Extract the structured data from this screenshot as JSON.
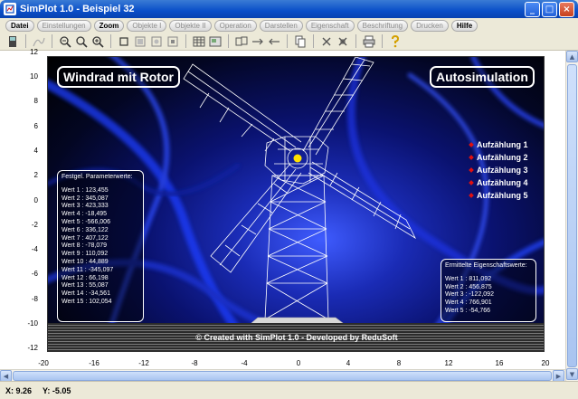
{
  "window": {
    "title": "SimPlot 1.0 - Beispiel 32",
    "minimize": "_",
    "maximize": "□",
    "close": "×"
  },
  "menu": [
    "Datei",
    "Einstellungen",
    "Zoom",
    "Objekte I",
    "Objekte II",
    "Operation",
    "Darstellen",
    "Eigenschaft",
    "Beschriftung",
    "Drucken",
    "Hilfe"
  ],
  "toolbar_icons": [
    "device-icon",
    "curve-icon",
    "zoom-in-icon",
    "zoom-icon",
    "zoom-plus-icon",
    "square-icon",
    "box-icon",
    "box2-icon",
    "box3-icon",
    "grid-icon",
    "grid2-icon",
    "copy-icon",
    "arrow-right-icon",
    "arrow-left-icon",
    "pages-icon",
    "cross-icon",
    "cross2-icon",
    "print-icon",
    "help-icon"
  ],
  "axes": {
    "y_ticks": [
      "12",
      "10",
      "8",
      "6",
      "4",
      "2",
      "0",
      "-2",
      "-4",
      "-6",
      "-8",
      "-10",
      "-12"
    ],
    "x_ticks": [
      "-20",
      "-16",
      "-12",
      "-8",
      "-4",
      "0",
      "4",
      "8",
      "12",
      "16",
      "20"
    ]
  },
  "chart": {
    "title": "Windrad mit Rotor",
    "mode": "Autosimulation",
    "params_title": "Festgel. Parameterwerte:",
    "params": [
      "Wert 1 : 123,455",
      "Wert 2 : 345,087",
      "Wert 3 : 423,333",
      "Wert 4 : -18,495",
      "Wert 5 : -566,006",
      "Wert 6 : 336,122",
      "Wert 7 : 407,122",
      "Wert 8 : -78,079",
      "Wert 9 : 110,092",
      "Wert 10 : 44,889",
      "Wert 11 : -345,097",
      "Wert 12 : 66,198",
      "Wert 13 : 55,087",
      "Wert 14 : -34,561",
      "Wert 15 : 102,054"
    ],
    "enumeration": [
      "Aufzählung 1",
      "Aufzählung 2",
      "Aufzählung 3",
      "Aufzählung 4",
      "Aufzählung 5"
    ],
    "results_title": "Ermittelte Eigenschaftswerte:",
    "results": [
      "Wert 1 : 811,092",
      "Wert 2 : 456,875",
      "Wert 3 : -122,092",
      "Wert 4 : 766,901",
      "Wert 5 : -54,766"
    ],
    "credit": "© Created with SimPlot 1.0 - Developed by ReduSoft"
  },
  "status": {
    "x": "X: 9.26",
    "y": "Y: -5.05"
  },
  "colors": {
    "title_bar": "#0a4fc9",
    "hub": "#ffe000",
    "bullet": "#e01010"
  }
}
